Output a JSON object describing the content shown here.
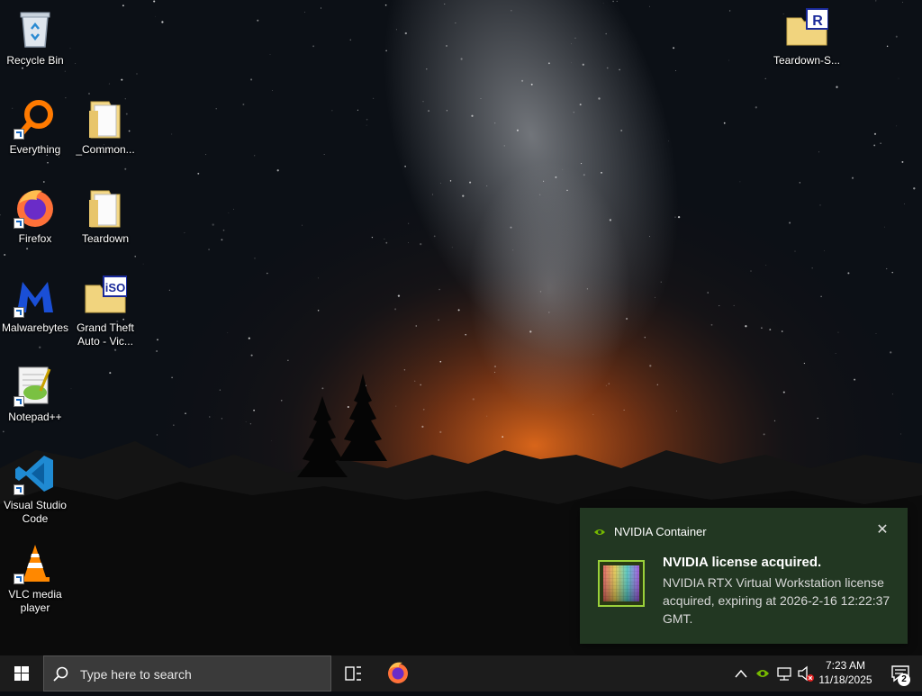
{
  "desktop": {
    "icons": [
      {
        "label": "Recycle Bin",
        "icon": "recycle-bin-icon"
      },
      {
        "label": "Everything",
        "icon": "everything-icon"
      },
      {
        "label": "_Common...",
        "icon": "folder-icon"
      },
      {
        "label": "Firefox",
        "icon": "firefox-icon"
      },
      {
        "label": "Teardown",
        "icon": "folder-icon"
      },
      {
        "label": "Malwarebytes",
        "icon": "malwarebytes-icon"
      },
      {
        "label": "Grand Theft Auto - Vic...",
        "icon": "iso-folder-icon",
        "badge": "iSO"
      },
      {
        "label": "Notepad++",
        "icon": "notepadpp-icon"
      },
      {
        "label": "Visual Studio Code",
        "icon": "vscode-icon"
      },
      {
        "label": "VLC media player",
        "icon": "vlc-icon"
      },
      {
        "label": "Teardown-S...",
        "icon": "rar-folder-icon",
        "badge": "R"
      }
    ]
  },
  "toast": {
    "app_name": "NVIDIA Container",
    "close": "✕",
    "title": "NVIDIA license acquired.",
    "message": "NVIDIA RTX Virtual Workstation license acquired, expiring at 2026-2-16 12:22:37 GMT."
  },
  "taskbar": {
    "search_placeholder": "Type here to search",
    "time": "7:23 AM",
    "date": "11/18/2025",
    "notification_count": "2"
  },
  "colors": {
    "accent_nvidia": "#76b900",
    "taskbar": "#1c1c1c",
    "toast_bg": "#243a24"
  }
}
